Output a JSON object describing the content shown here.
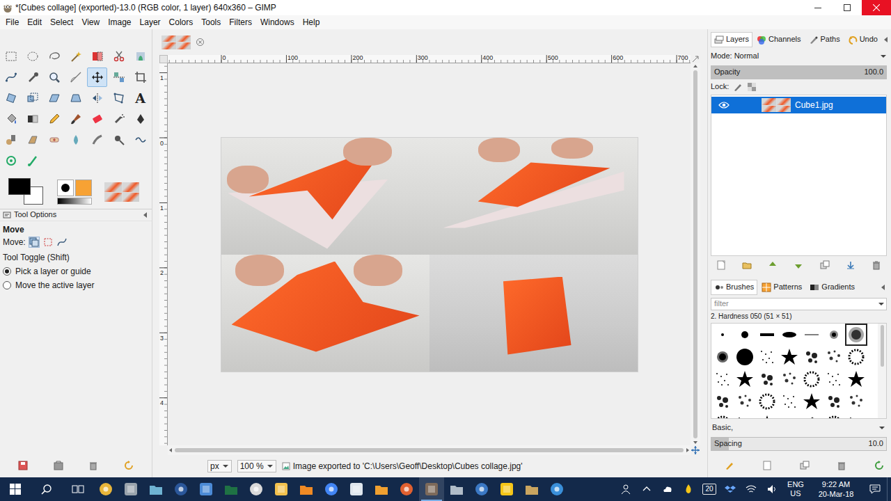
{
  "window": {
    "title": "*[Cubes collage] (exported)-13.0 (RGB color, 1 layer) 640x360 – GIMP",
    "close_hovered": true
  },
  "menu": [
    "File",
    "Edit",
    "Select",
    "View",
    "Image",
    "Layer",
    "Colors",
    "Tools",
    "Filters",
    "Windows",
    "Help"
  ],
  "toolbox": {
    "tools": [
      {
        "selected": false
      },
      {
        "selected": false
      },
      {
        "selected": false
      },
      {
        "selected": false
      },
      {
        "selected": false
      },
      {
        "selected": false
      },
      {
        "selected": false
      },
      {
        "selected": false
      },
      {
        "selected": false
      },
      {
        "selected": false
      },
      {
        "selected": false
      },
      {
        "selected": true
      },
      {
        "selected": false
      },
      {
        "selected": false
      },
      {
        "selected": false
      },
      {
        "selected": false
      },
      {
        "selected": false
      },
      {
        "selected": false
      },
      {
        "selected": false
      },
      {
        "selected": false
      },
      {
        "selected": false,
        "glyph": "A"
      },
      {
        "selected": false
      },
      {
        "selected": false
      },
      {
        "selected": false
      },
      {
        "selected": false
      },
      {
        "selected": false
      },
      {
        "selected": false
      },
      {
        "selected": false
      },
      {
        "selected": false
      },
      {
        "selected": false
      },
      {
        "selected": false
      },
      {
        "selected": false
      },
      {
        "selected": false
      },
      {
        "selected": false
      },
      {
        "selected": false
      },
      {
        "selected": false
      },
      {
        "selected": false
      }
    ],
    "fg_color": "#000000",
    "bg_color": "#ffffff"
  },
  "tool_options": {
    "title": "Tool Options",
    "tool": "Move",
    "move_label": "Move:",
    "move_modes": [
      {
        "selected": true
      },
      {
        "selected": false
      },
      {
        "selected": false
      }
    ],
    "toggle_label": "Tool Toggle  (Shift)",
    "options": [
      {
        "label": "Pick a layer or guide",
        "selected": true
      },
      {
        "label": "Move the active layer",
        "selected": false
      }
    ]
  },
  "rulers": {
    "top": [
      "0",
      "100",
      "200",
      "300",
      "400",
      "500",
      "600",
      "700"
    ],
    "left": [
      "1",
      "0",
      "1",
      "2",
      "3",
      "4"
    ]
  },
  "status_bar": {
    "unit": "px",
    "zoom": "100 %",
    "message": "Image exported to 'C:\\Users\\Geoff\\Desktop\\Cubes collage.jpg'"
  },
  "layers_panel": {
    "tabs": [
      {
        "label": "Layers",
        "selected": true
      },
      {
        "label": "Channels",
        "selected": false
      },
      {
        "label": "Paths",
        "selected": false
      },
      {
        "label": "Undo",
        "selected": false
      }
    ],
    "mode": "Mode: Normal",
    "opacity": {
      "label": "Opacity",
      "value": "100.0",
      "level": 1
    },
    "lock": "Lock:",
    "layers": [
      {
        "name": "Cube1.jpg",
        "visible": true,
        "selected": true
      }
    ]
  },
  "brushes_panel": {
    "tabs": [
      {
        "label": "Brushes",
        "selected": true
      },
      {
        "label": "Patterns",
        "selected": false
      },
      {
        "label": "Gradients",
        "selected": false
      }
    ],
    "filter_placeholder": "filter",
    "brush_name": "2. Hardness 050 (51 × 51)",
    "brushes": [
      {
        "selected": false
      },
      {
        "selected": false
      },
      {
        "selected": false
      },
      {
        "selected": false
      },
      {
        "selected": false
      },
      {
        "selected": false
      },
      {
        "selected": true
      },
      {
        "selected": false
      },
      {
        "selected": false
      },
      {
        "selected": false
      },
      {
        "selected": false
      },
      {
        "selected": false
      },
      {
        "selected": false
      },
      {
        "selected": false
      },
      {
        "selected": false
      },
      {
        "selected": false
      },
      {
        "selected": false
      },
      {
        "selected": false
      },
      {
        "selected": false
      },
      {
        "selected": false
      },
      {
        "selected": false
      },
      {
        "selected": false
      },
      {
        "selected": false
      },
      {
        "selected": false
      },
      {
        "selected": false
      },
      {
        "selected": false
      },
      {
        "selected": false
      },
      {
        "selected": false
      },
      {
        "selected": false
      },
      {
        "selected": false
      },
      {
        "selected": false
      },
      {
        "selected": false
      },
      {
        "selected": false
      },
      {
        "selected": false
      },
      {
        "selected": false
      }
    ],
    "preset": "Basic,",
    "spacing": {
      "label": "Spacing",
      "value": "10.0",
      "level": 0.1
    }
  },
  "taskbar": {
    "apps": [
      {
        "selected": false
      },
      {
        "selected": false
      },
      {
        "selected": false
      },
      {
        "selected": false
      },
      {
        "selected": false
      },
      {
        "selected": false
      },
      {
        "selected": false
      },
      {
        "selected": false
      },
      {
        "selected": false
      },
      {
        "selected": false
      },
      {
        "selected": false
      },
      {
        "selected": false
      },
      {
        "selected": false
      },
      {
        "selected": true
      },
      {
        "selected": false
      },
      {
        "selected": false
      },
      {
        "selected": false
      },
      {
        "selected": false
      },
      {
        "selected": false
      }
    ],
    "calendar_badge": "20",
    "language": "ENG",
    "region": "US",
    "time": "9:22 AM",
    "date": "20-Mar-18"
  }
}
